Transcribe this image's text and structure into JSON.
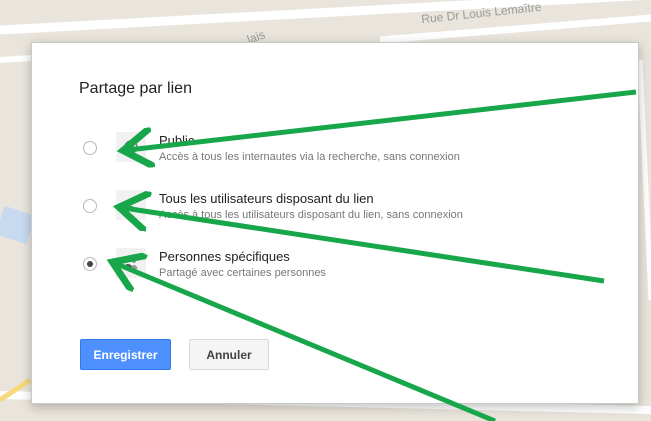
{
  "map": {
    "street_label": "Rue Dr Louis Lemaître",
    "fragment_label": "lais"
  },
  "dialog": {
    "title": "Partage par lien",
    "options": [
      {
        "title": "Public",
        "description": "Accès à tous les internautes via la recherche, sans connexion",
        "selected": false,
        "icon": "globe-icon"
      },
      {
        "title": "Tous les utilisateurs disposant du lien",
        "description": "Accès à tous les utilisateurs disposant du lien, sans connexion",
        "selected": false,
        "icon": "person-link-icon"
      },
      {
        "title": "Personnes spécifiques",
        "description": "Partagé avec certaines personnes",
        "selected": true,
        "icon": "people-icon"
      }
    ],
    "buttons": {
      "save": "Enregistrer",
      "cancel": "Annuler"
    }
  },
  "colors": {
    "primary_button": "#4d90fe",
    "annotation_arrow": "#17a74a",
    "map_background": "#e9e5dc"
  }
}
